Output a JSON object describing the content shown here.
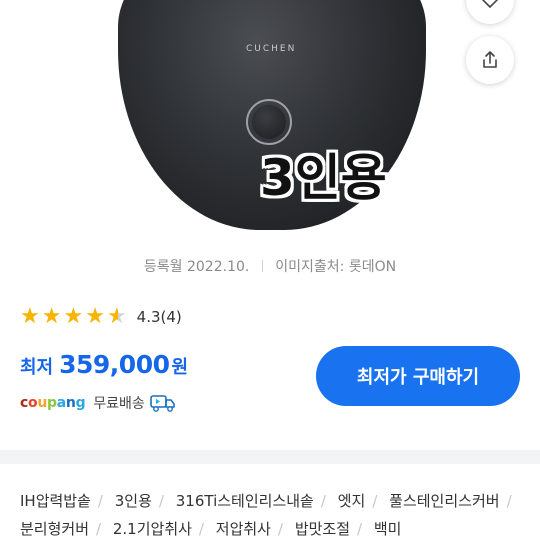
{
  "hero": {
    "brand": "CUCHEN",
    "overlay_text": "3인용"
  },
  "meta": {
    "registered": "등록월 2022.10.",
    "image_source": "이미지출처: 롯데ON"
  },
  "rating": {
    "stars_total": 5,
    "stars_value": 4.3,
    "score": "4.3",
    "count": "(4)"
  },
  "price": {
    "label": "최저",
    "amount": "359,000",
    "unit": "원"
  },
  "shop": {
    "name": "coupang",
    "shipping": "무료배송"
  },
  "buy_button": {
    "label": "최저가 구매하기"
  },
  "tags": [
    "IH압력밥솥",
    "3인용",
    "316Ti스테인리스내솥",
    "엣지",
    "풀스테인리스커버",
    "분리형커버",
    "2.1기압취사",
    "저압취사",
    "밥맛조절",
    "백미"
  ],
  "colors": {
    "accent": "#1972ef",
    "price_blue": "#1566e8",
    "star": "#f7b400",
    "coupang_c": "#a72a1c",
    "coupang_o": "#e4442a",
    "coupang_u": "#f3a72a",
    "coupang_p": "#8cc63e",
    "coupang_a": "#2ba8df",
    "coupang_n": "#1a6fc1",
    "coupang_g": "#2ba8df"
  }
}
